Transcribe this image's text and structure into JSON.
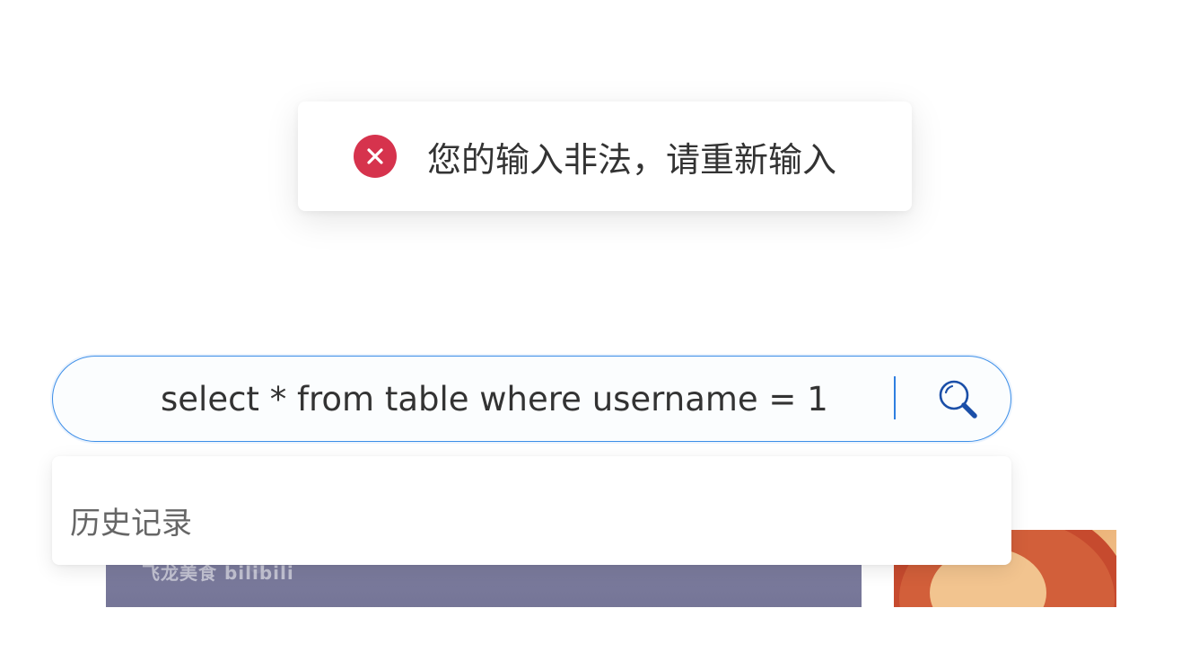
{
  "toast": {
    "message": "您的输入非法，请重新输入",
    "icon": "error-icon",
    "color": "#d6334d"
  },
  "search": {
    "value": "select * from table where username = 1",
    "icon": "search-icon",
    "accent": "#3c8ee8"
  },
  "dropdown": {
    "title": "历史记录"
  },
  "background": {
    "watermark": "飞龙美食 bilibili"
  }
}
